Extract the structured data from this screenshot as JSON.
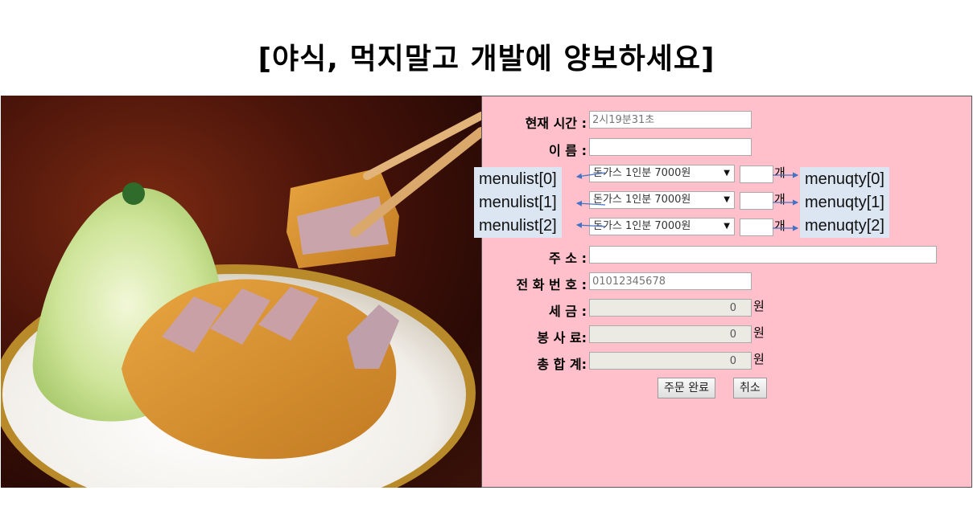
{
  "page": {
    "title": "[야식, 먹지말고 개발에 양보하세요]"
  },
  "form": {
    "time_label": "현재 시간 :",
    "time_placeholder": "2시19분31초",
    "name_label": "이 름 :",
    "name_value": "",
    "menu_rows": [
      {
        "option": "돈가스 1인분 7000원",
        "qty": "",
        "unit": "개",
        "list_annotation": "menulist[0]",
        "qty_annotation": "menuqty[0]"
      },
      {
        "option": "돈가스 1인분 7000원",
        "qty": "",
        "unit": "개",
        "list_annotation": "menulist[1]",
        "qty_annotation": "menuqty[1]"
      },
      {
        "option": "돈가스 1인분 7000원",
        "qty": "",
        "unit": "개",
        "list_annotation": "menulist[2]",
        "qty_annotation": "menuqty[2]"
      }
    ],
    "address_label": "주 소 :",
    "address_value": "",
    "phone_label": "전 화 번 호 :",
    "phone_placeholder": "01012345678",
    "tax_label": "세 금 :",
    "tax_value": "0",
    "service_label": "봉 사 료:",
    "service_value": "0",
    "total_label": "총 합 계:",
    "total_value": "0",
    "currency_unit": "원",
    "submit_label": "주문 완료",
    "cancel_label": "취소"
  },
  "colors": {
    "panel_bg": "#ffc0cb",
    "annotation_bg": "#dce6f2",
    "arrow": "#4472c4"
  },
  "icons": {
    "select_arrow": "dropdown-arrow-icon"
  }
}
